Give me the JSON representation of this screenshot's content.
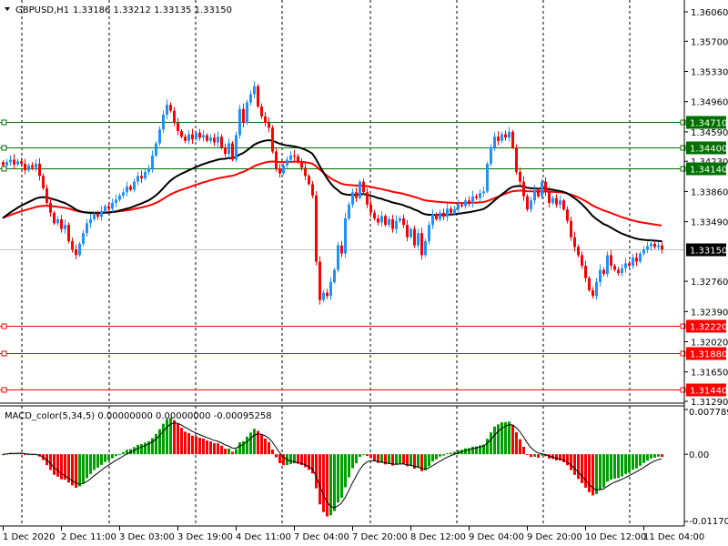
{
  "header": {
    "symbol_label": "GBPUSD,H1",
    "ohlc_label": "1.33186 1.33212 1.33135 1.33150",
    "menu_icon": "triangle-down-icon"
  },
  "indicator": {
    "label": "MACD_color(5,34,5) 0.00000000 0.00000000 -0.00095258"
  },
  "colors": {
    "bull": "#1e90ff",
    "bear": "#ff0000",
    "ma_fast": "#000000",
    "ma_slow": "#ff0000",
    "support_lines": "#ff0000",
    "resistance_lines": "#007000",
    "macd_up": "#00a000",
    "macd_down": "#ff0000"
  },
  "chart_data": {
    "type": "candlestick",
    "title": "GBPUSD,H1",
    "timeframe": "H1",
    "ylim": [
      1.3129,
      1.3606
    ],
    "grid": "vertical-dashed",
    "price_ticks": [
      "1.36060",
      "1.35700",
      "1.35330",
      "1.34960",
      "1.34590",
      "1.34230",
      "1.33860",
      "1.33490",
      "1.32760",
      "1.32390",
      "1.32020",
      "1.31650",
      "1.31290"
    ],
    "time_ticks": [
      "1 Dec 2020",
      "2 Dec 11:00",
      "3 Dec 03:00",
      "3 Dec 19:00",
      "4 Dec 11:00",
      "7 Dec 04:00",
      "7 Dec 20:00",
      "8 Dec 12:00",
      "9 Dec 04:00",
      "9 Dec 20:00",
      "10 Dec 12:00",
      "11 Dec 04:00"
    ],
    "current_price": "1.33150",
    "levels_green": [
      "1.34710",
      "1.34400",
      "1.34140"
    ],
    "levels_red": [
      "1.32220",
      "1.31880",
      "1.31440"
    ],
    "closes": [
      1.3418,
      1.3422,
      1.3425,
      1.3419,
      1.3423,
      1.342,
      1.3412,
      1.3418,
      1.3415,
      1.342,
      1.3405,
      1.339,
      1.3372,
      1.336,
      1.3347,
      1.3352,
      1.334,
      1.3345,
      1.3325,
      1.3315,
      1.3308,
      1.3322,
      1.3335,
      1.3347,
      1.3352,
      1.3358,
      1.3355,
      1.3362,
      1.3368,
      1.3365,
      1.3372,
      1.3376,
      1.3381,
      1.3385,
      1.3392,
      1.3388,
      1.3398,
      1.3405,
      1.3402,
      1.341,
      1.3414,
      1.343,
      1.3445,
      1.3462,
      1.348,
      1.3492,
      1.3485,
      1.347,
      1.346,
      1.3453,
      1.3448,
      1.3456,
      1.345,
      1.3458,
      1.3452,
      1.3455,
      1.3448,
      1.3452,
      1.3446,
      1.3453,
      1.344,
      1.3432,
      1.3445,
      1.3425,
      1.3455,
      1.3487,
      1.347,
      1.3495,
      1.3505,
      1.3515,
      1.349,
      1.3478,
      1.347,
      1.3464,
      1.3435,
      1.3414,
      1.3408,
      1.3418,
      1.3425,
      1.343,
      1.3429,
      1.3422,
      1.3415,
      1.3405,
      1.3395,
      1.3381,
      1.33,
      1.3253,
      1.3262,
      1.3258,
      1.3275,
      1.329,
      1.332,
      1.331,
      1.3353,
      1.337,
      1.3385,
      1.3378,
      1.3398,
      1.3385,
      1.337,
      1.336,
      1.3353,
      1.3348,
      1.3356,
      1.3345,
      1.3352,
      1.334,
      1.335,
      1.3353,
      1.3345,
      1.333,
      1.334,
      1.332,
      1.3335,
      1.3308,
      1.3325,
      1.3345,
      1.3358,
      1.3352,
      1.336,
      1.3355,
      1.3365,
      1.336,
      1.3364,
      1.337,
      1.3368,
      1.3375,
      1.3372,
      1.338,
      1.3378,
      1.3384,
      1.3386,
      1.342,
      1.344,
      1.3453,
      1.3448,
      1.3456,
      1.3452,
      1.3459,
      1.344,
      1.341,
      1.3398,
      1.338,
      1.3364,
      1.3375,
      1.3388,
      1.338,
      1.3398,
      1.3385,
      1.3372,
      1.3378,
      1.337,
      1.3375,
      1.3364,
      1.335,
      1.333,
      1.3318,
      1.3308,
      1.3295,
      1.328,
      1.3265,
      1.3258,
      1.3275,
      1.329,
      1.3285,
      1.3308,
      1.3295,
      1.329,
      1.3286,
      1.3292,
      1.3298,
      1.3295,
      1.3305,
      1.33,
      1.331,
      1.3315,
      1.3319,
      1.3322,
      1.3318,
      1.332,
      1.3315
    ],
    "macd": {
      "params": "5,34,5",
      "ylim": [
        -0.011702,
        0.0077894
      ],
      "ticks": [
        "0.0077894",
        "0.00",
        "-0.011702"
      ]
    }
  }
}
